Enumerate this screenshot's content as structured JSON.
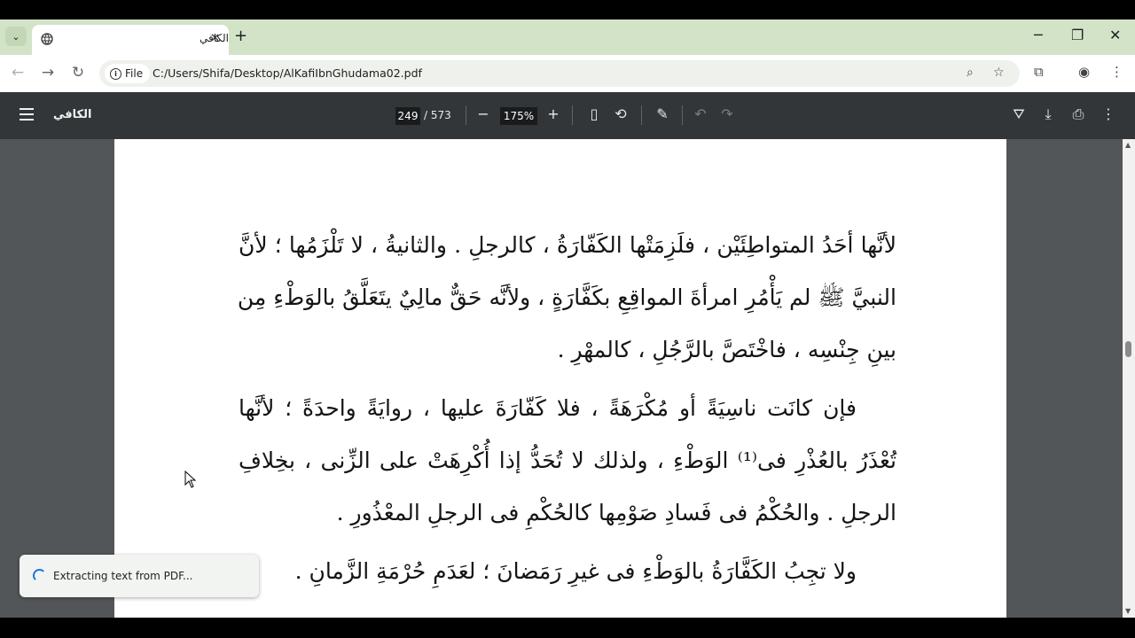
{
  "tab": {
    "title": "الكافي",
    "close": "✕"
  },
  "window_controls": {
    "minimize": "─",
    "restore": "❐",
    "close": "✕"
  },
  "new_tab": "+",
  "omnibox": {
    "chip_label": "File",
    "url": "C:/Users/Shifa/Desktop/AlKafiIbnGhudama02.pdf"
  },
  "pdf_toolbar": {
    "doc_title": "الكافي",
    "current_page": "249",
    "total_pages": "/ 573",
    "zoom": "175%",
    "zoom_out": "−",
    "zoom_in": "+"
  },
  "document": {
    "paragraphs": [
      {
        "lines": [
          "لأنَّها أحَدُ المتواطِئَيْن ، فلَزِمَتْها الكَفّارَةُ ، كالرجلِ . والثانيةُ ، لا تَلْزَمُها ؛ لأنَّ",
          "النبيَّ ﷺ لم يَأْمُرِ امرأةَ المواقِعِ بكَفَّارَةٍ ، ولأنَّه حَقٌّ مالِيٌ يتَعَلَّقُ بالوَطْءِ مِن",
          "بينِ جِنْسِه ، فاخْتَصَّ بالرَّجُلِ ، كالمهْرِ ."
        ]
      },
      {
        "lines": [
          "فإن كانَت ناسِيَةً أو مُكْرَهَةً ، فلا كَفّارَةَ عليها ، روايَةً واحدَةً ؛ لأنَّها",
          "تُعْذَرُ بالعُذْرِ فى⁽¹⁾ الوَطْءِ ، ولذلك لا تُحَدُّ إذا أُكْرِهَتْ على الزِّنى ، بخِلافِ",
          "الرجلِ . والحُكْمُ فى فَسادِ صَوْمِها كالحُكْمِ فى الرجلِ المعْذُورِ ."
        ]
      },
      {
        "lines": [
          "ولا تجِبُ الكَفَّارَةُ بالوَطْءِ فى غيرِ رَمَضانَ ؛ لعَدَمِ حُرْمَةِ الزَّمانِ ."
        ]
      }
    ]
  },
  "toast": {
    "text": "Extracting text from PDF..."
  },
  "colors": {
    "chrome_tabstrip": "#d3e3c8",
    "pdf_toolbar": "#323639",
    "viewer_bg": "#525659",
    "spinner": "#1a73e8"
  }
}
